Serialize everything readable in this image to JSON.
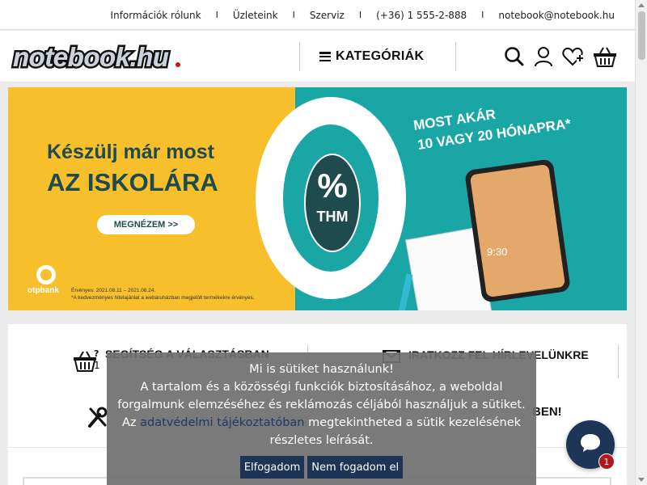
{
  "topbar": {
    "links": [
      {
        "label": "Információk rólunk"
      },
      {
        "label": "Üzleteink"
      },
      {
        "label": "Szerviz"
      },
      {
        "label": "(+36) 1 555-2-888"
      },
      {
        "label": "notebook@notebook.hu"
      }
    ],
    "separator": "I"
  },
  "header": {
    "logo_text": "notebook.hu",
    "categories_label": "KATEGÓRIÁK",
    "icons": [
      "search-icon",
      "user-icon",
      "wishlist-heart-plus-icon",
      "cart-basket-icon"
    ]
  },
  "banner": {
    "headline_1": "Készülj már most",
    "headline_2": "AZ ISKOLÁRA",
    "button_label": "MEGNÉZEM >>",
    "percent": "%",
    "thm": "THM",
    "offer_1": "MOST AKÁR",
    "offer_2": "10 VAGY 20 HÓNAPRA*",
    "tablet_time": "9:30",
    "bank": "otpbank",
    "validity": "Érvényes: 2021.08.11 – 2021.08.24.",
    "footnote": "*A kedvezményes hitelajánlat a webáruházban megjelölt termékekre érvényes.",
    "colors": {
      "yellow": "#f6bf2b",
      "teal": "#1ba6a6",
      "dark": "#1f4a4e"
    }
  },
  "info": {
    "help_title": "SEGÍTSÉG A VÁLASZTÁSBAN",
    "help_sub": "1",
    "newsletter_title": "IRATKOZZ FEL HÍRLEVELÜNKRE",
    "service_title": "BEN!"
  },
  "cookie": {
    "title": "Mi is sütiket használunk!",
    "text_1": "A tartalom és a közösségi funkciók biztosításához, a weboldal forgalmunk elemzéséhez és reklámozás céljából használjuk a sütiket.",
    "text_2_pre": "Az",
    "link": "adatvédelmi tájékoztatóban",
    "text_2_post": "megtekintheted a sütik kezelésének részletes leírását.",
    "accept": "Elfogadom",
    "decline": "Nem fogadom el"
  },
  "chat": {
    "badge": "1"
  }
}
